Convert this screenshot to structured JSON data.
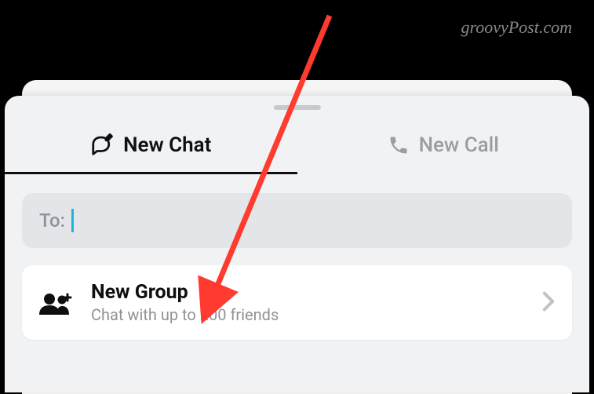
{
  "watermark": "groovyPost.com",
  "tabs": {
    "new_chat_label": "New Chat",
    "new_call_label": "New Call"
  },
  "to_field": {
    "label": "To:",
    "value": ""
  },
  "group_item": {
    "title": "New Group",
    "subtitle": "Chat with up to 200 friends"
  }
}
